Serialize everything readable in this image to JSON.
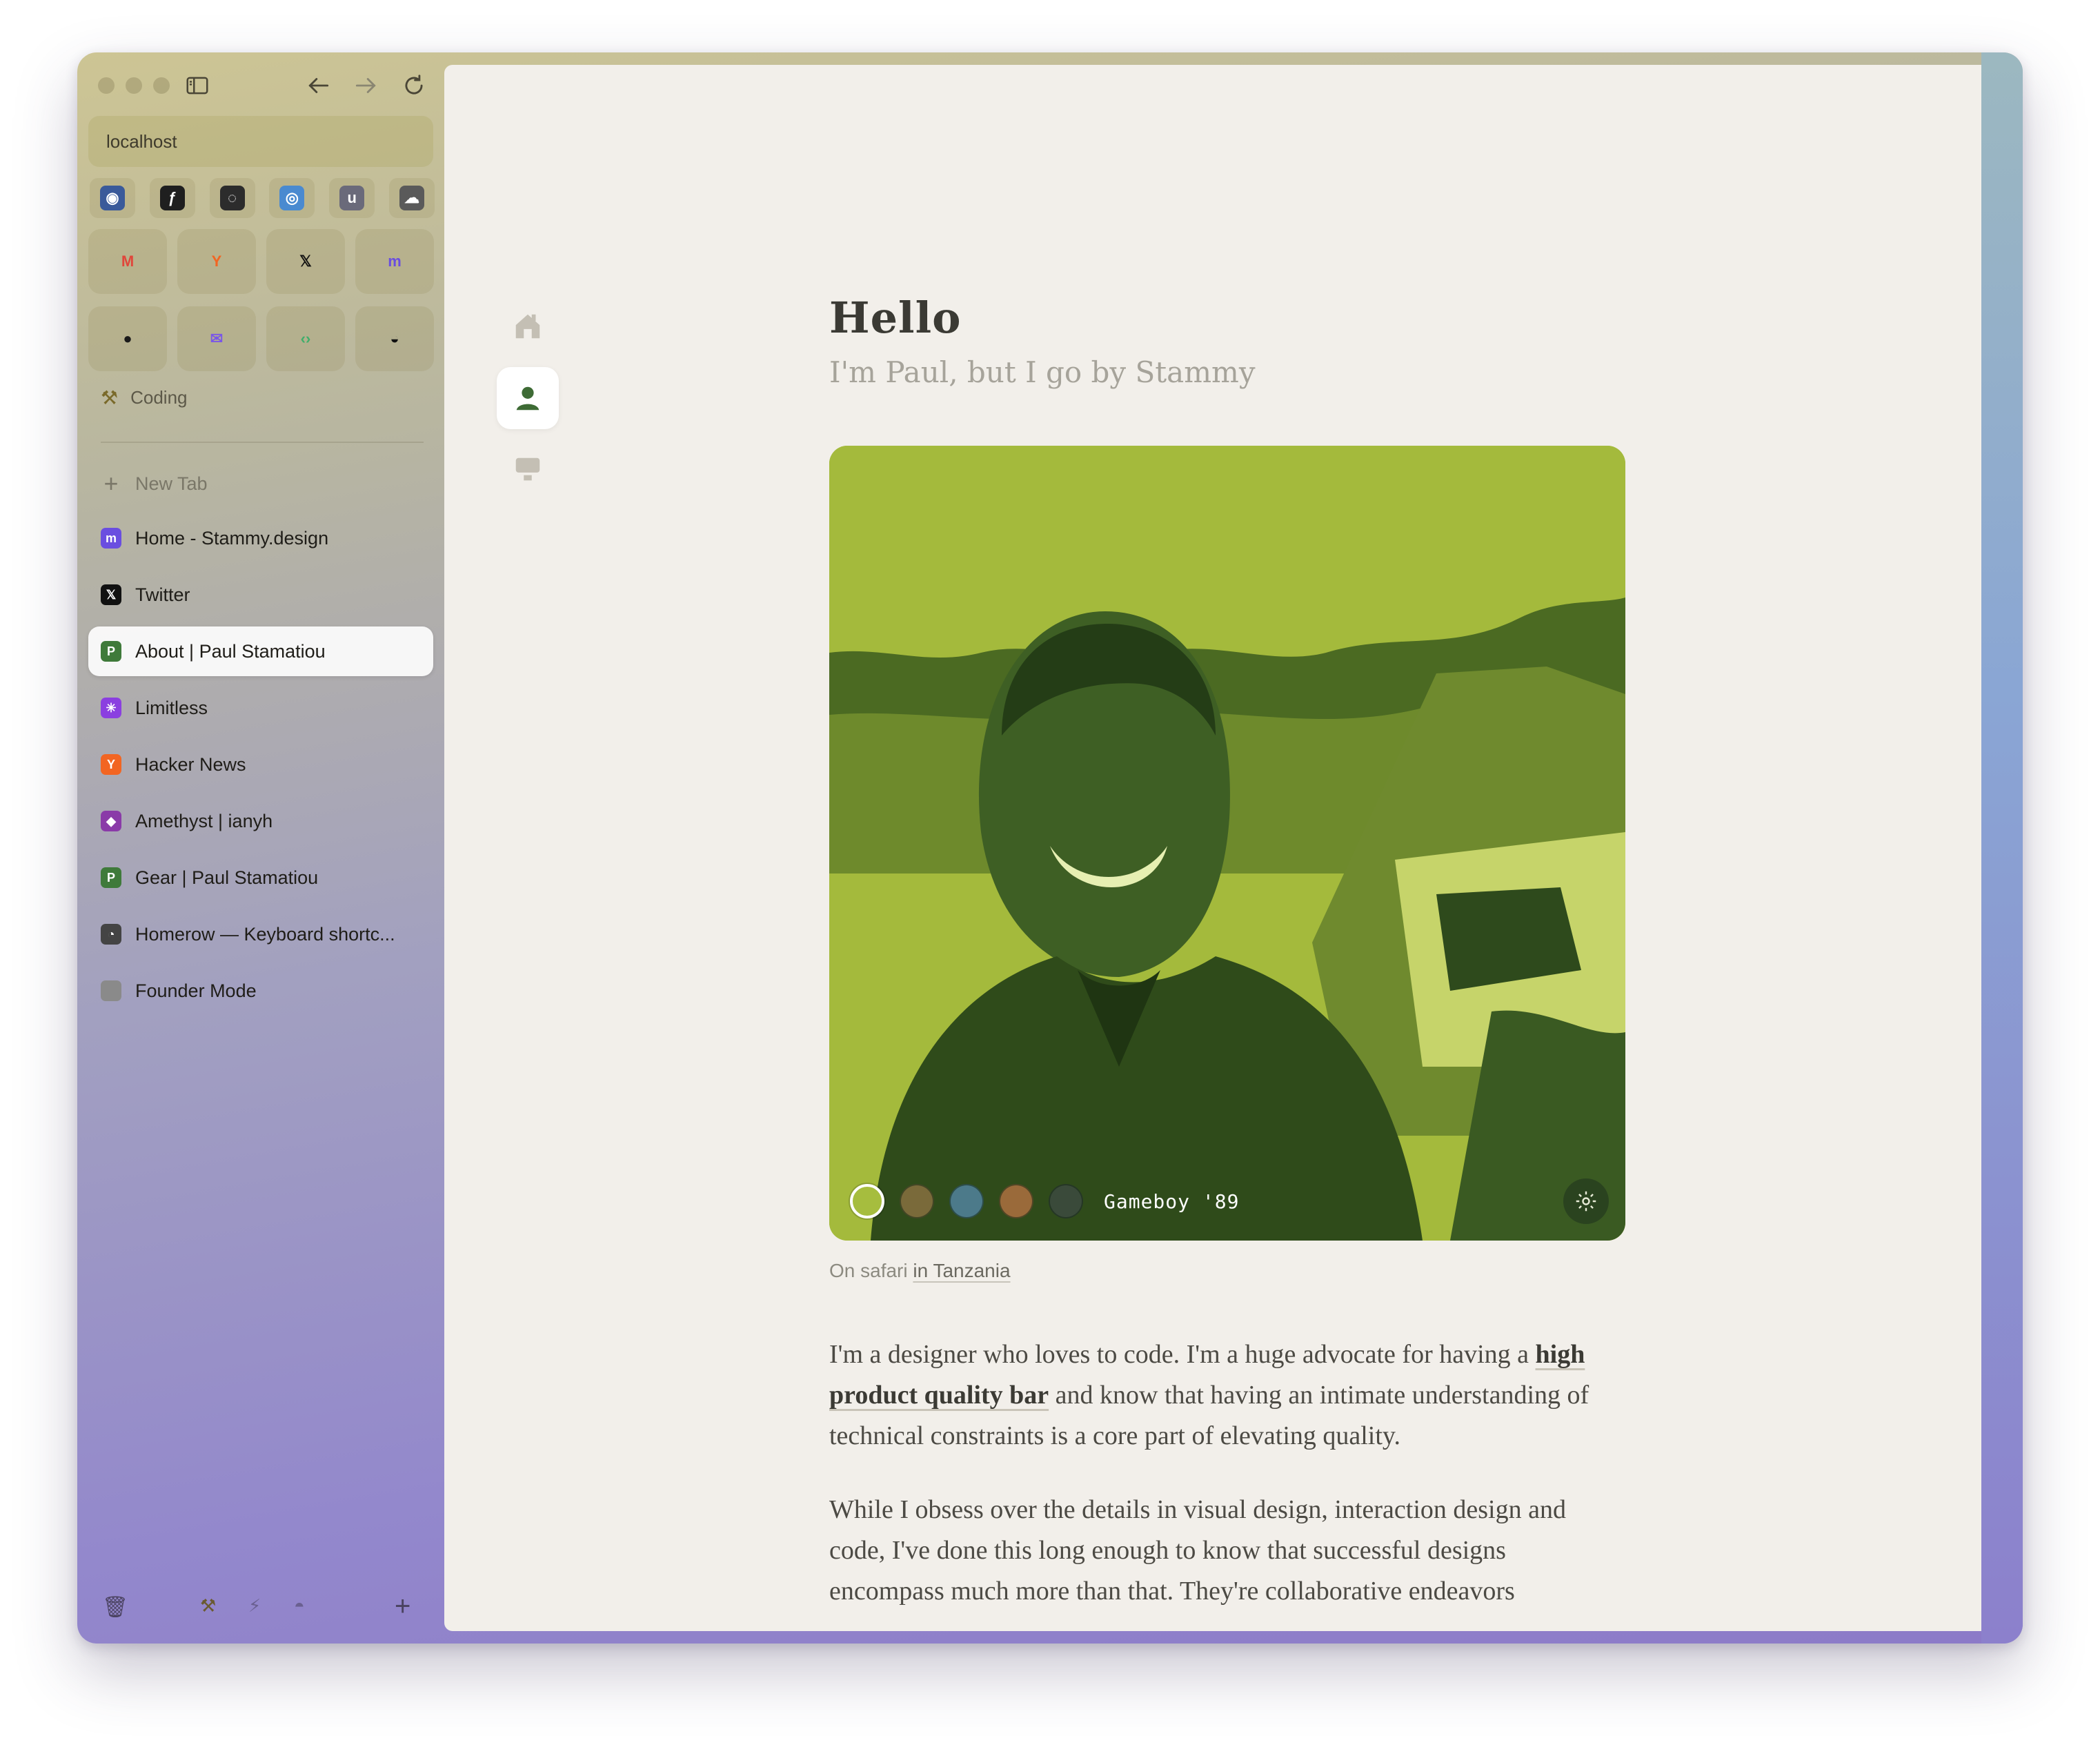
{
  "browser": {
    "url": "localhost",
    "extensions": [
      {
        "icon": "password-manager-icon",
        "color": "#3a5a9a",
        "char": "◉"
      },
      {
        "icon": "fontface-ninja-icon",
        "color": "#1f1f1f",
        "char": "ƒ"
      },
      {
        "icon": "hide-eye-icon",
        "color": "#2c2c2c",
        "char": "◌"
      },
      {
        "icon": "browser-sphere-icon",
        "color": "#4a8ad0",
        "char": "◎"
      },
      {
        "icon": "ublock-shield-icon",
        "color": "#6a6a7a",
        "char": "u"
      },
      {
        "icon": "cloud-icon",
        "color": "#5a5a5a",
        "char": "☁"
      }
    ],
    "favorites": [
      {
        "icon": "gmail-icon",
        "color": "#e0463a",
        "char": "M"
      },
      {
        "icon": "hacker-news-icon",
        "color": "#f26522",
        "char": "Y"
      },
      {
        "icon": "x-icon",
        "color": "#111111",
        "char": "𝕏"
      },
      {
        "icon": "mastodon-icon",
        "color": "#6a4ee0",
        "char": "m"
      },
      {
        "icon": "github-icon",
        "color": "#1a1a1a",
        "char": "●"
      },
      {
        "icon": "mail-app-icon",
        "color": "#7a56e8",
        "char": "✉"
      },
      {
        "icon": "code-app-icon",
        "color": "#3fae6a",
        "char": "‹›"
      },
      {
        "icon": "ai-chat-icon",
        "color": "#111111",
        "char": "◒"
      }
    ],
    "folder": "Coding",
    "new_tab": "New Tab",
    "tabs": [
      {
        "title": "Home - Stammy.design",
        "icon": "mastodon-icon",
        "color": "#6a4ee0",
        "char": "m",
        "active": false
      },
      {
        "title": "Twitter",
        "icon": "x-icon",
        "color": "#111111",
        "char": "𝕏",
        "active": false
      },
      {
        "title": "About | Paul Stamatiou",
        "icon": "stamatiou-logo-icon",
        "color": "#3f7a3a",
        "char": "P",
        "active": true
      },
      {
        "title": "Limitless",
        "icon": "limitless-icon",
        "color": "#8b3fe0",
        "char": "✳",
        "active": false
      },
      {
        "title": "Hacker News",
        "icon": "hacker-news-icon",
        "color": "#f26522",
        "char": "Y",
        "active": false
      },
      {
        "title": "Amethyst | ianyh",
        "icon": "amethyst-icon",
        "color": "#8a3aa8",
        "char": "◆",
        "active": false
      },
      {
        "title": "Gear | Paul Stamatiou",
        "icon": "stamatiou-logo-icon",
        "color": "#3f7a3a",
        "char": "P",
        "active": false
      },
      {
        "title": "Homerow — Keyboard shortc...",
        "icon": "homerow-icon",
        "color": "#444444",
        "char": "◔",
        "active": false
      },
      {
        "title": "Founder Mode",
        "icon": "page-icon",
        "color": "#8a8a8a",
        "char": "",
        "active": false
      }
    ]
  },
  "page": {
    "title": "Hello",
    "subtitle": "I'm Paul, but I go by Stammy",
    "photo": {
      "palette_name": "Gameboy '89",
      "swatches": [
        "#a6bd3e",
        "#7a6a3a",
        "#4c7a8a",
        "#9a6a3a",
        "#3a4a3a"
      ]
    },
    "caption_prefix": "On safari ",
    "caption_link": "in Tanzania",
    "para1_a": "I'm a designer who loves to code. I'm a huge advocate for having a ",
    "para1_link": "high product quality bar",
    "para1_b": " and know that having an intimate understanding of technical constraints is a core part of elevating quality.",
    "para2": "While I obsess over the details in visual design, interaction design and code, I've done this long enough to know that successful designs encompass much more than that. They're collaborative endeavors"
  }
}
